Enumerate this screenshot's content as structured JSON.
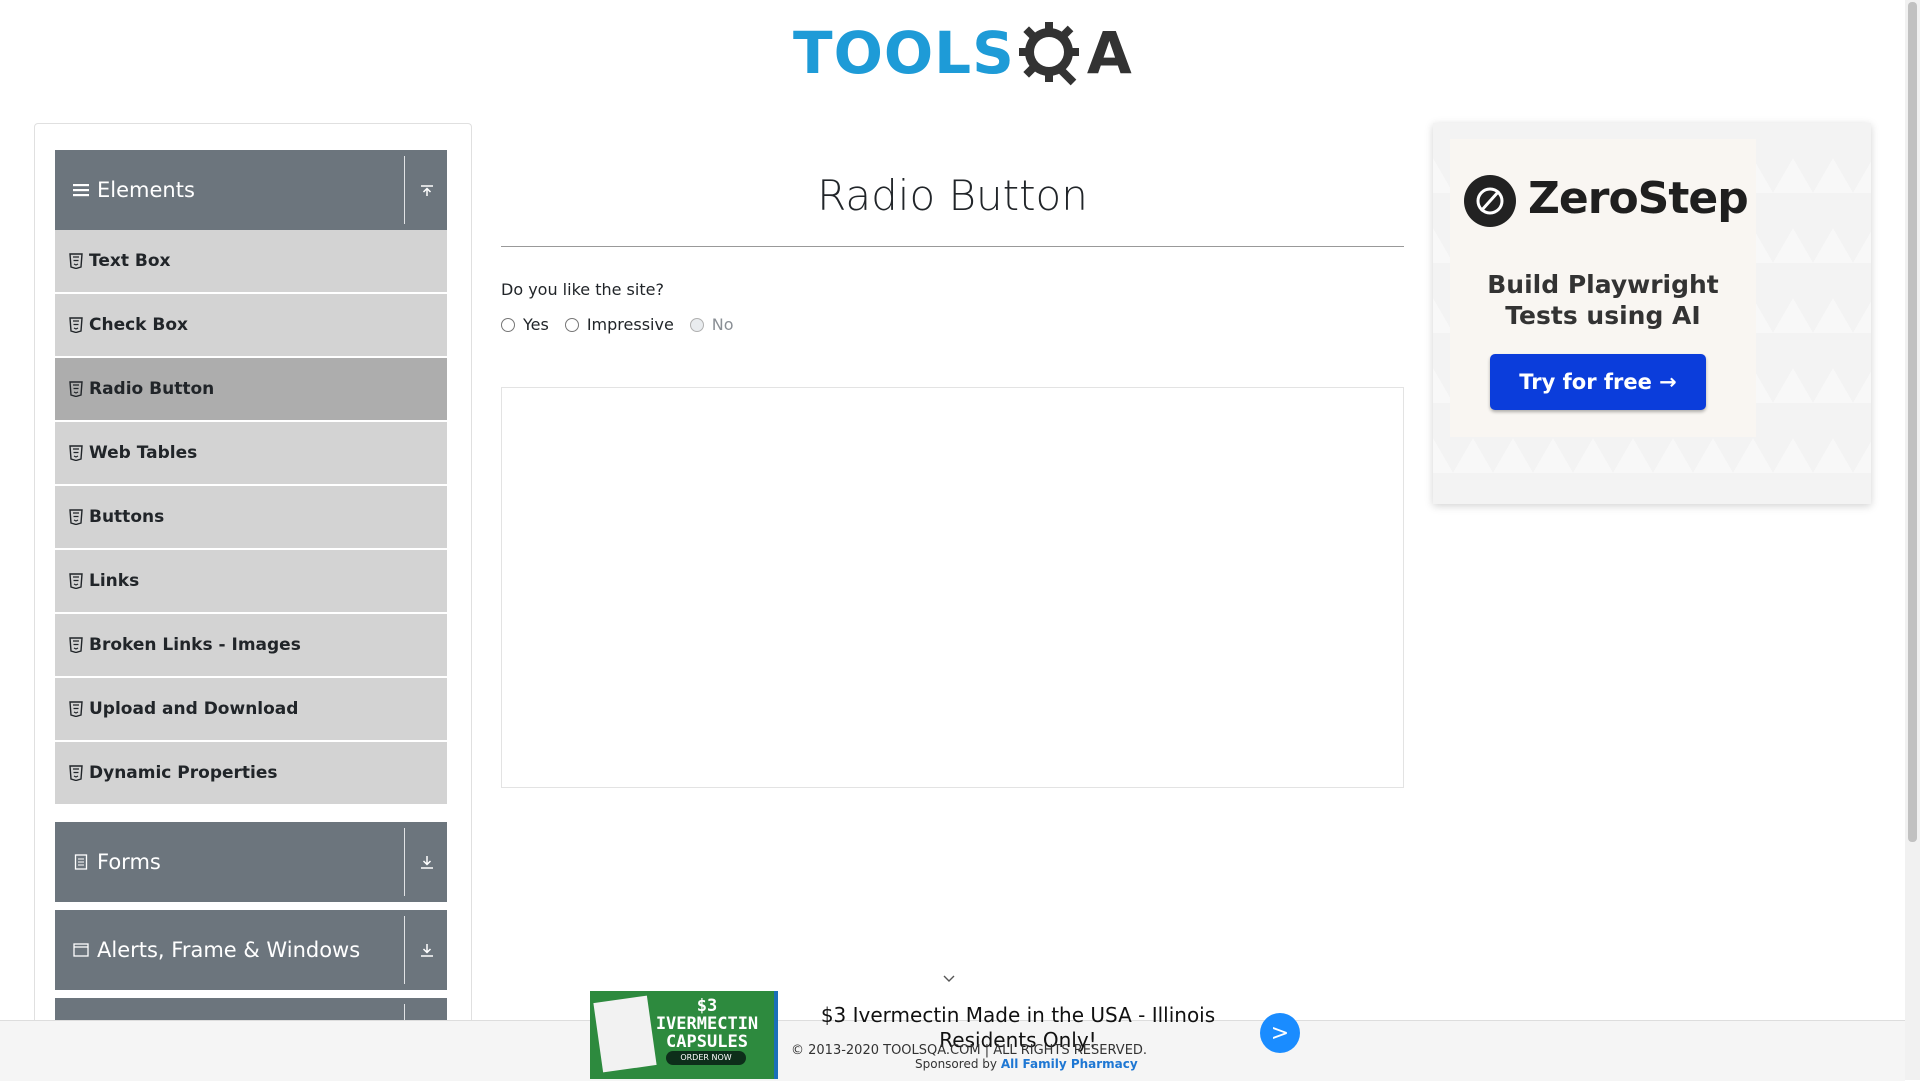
{
  "header": {
    "logo_text_tools": "TOOLS",
    "logo_text_qa": "A"
  },
  "sidebar": {
    "groups": [
      {
        "title": "Elements"
      },
      {
        "title": "Forms"
      },
      {
        "title": "Alerts, Frame & Windows"
      }
    ],
    "elements_items": [
      {
        "label": "Text Box"
      },
      {
        "label": "Check Box"
      },
      {
        "label": "Radio Button"
      },
      {
        "label": "Web Tables"
      },
      {
        "label": "Buttons"
      },
      {
        "label": "Links"
      },
      {
        "label": "Broken Links - Images"
      },
      {
        "label": "Upload and Download"
      },
      {
        "label": "Dynamic Properties"
      }
    ],
    "active_item": "Radio Button"
  },
  "main": {
    "title": "Radio Button",
    "question": "Do you like the site?",
    "radios": [
      {
        "label": "Yes",
        "disabled": false
      },
      {
        "label": "Impressive",
        "disabled": false
      },
      {
        "label": "No",
        "disabled": true
      }
    ]
  },
  "right_ad": {
    "brand": "ZeroStep",
    "tagline_1": "Build Playwright",
    "tagline_2": "Tests using AI",
    "cta": "Try for free →",
    "cta_color": "#0b3ddb"
  },
  "bottom_ad": {
    "thumb_text": "$3 IVERMECTIN CAPSULES",
    "thumb_cta": "ORDER NOW",
    "headline": "$3 Ivermectin Made in the USA - Illinois Residents Only!",
    "go_label": ">"
  },
  "footer": {
    "copyright": "© 2013-2020 TOOLSQA.COM | ALL RIGHTS RESERVED.",
    "sponsored_prefix": "Sponsored by",
    "sponsor_link": "All Family Pharmacy"
  },
  "colors": {
    "brand_blue": "#1e9bd7",
    "sidebar_header": "#6c757d",
    "menu_item": "#d3d3d3",
    "menu_item_active": "#adadad"
  }
}
